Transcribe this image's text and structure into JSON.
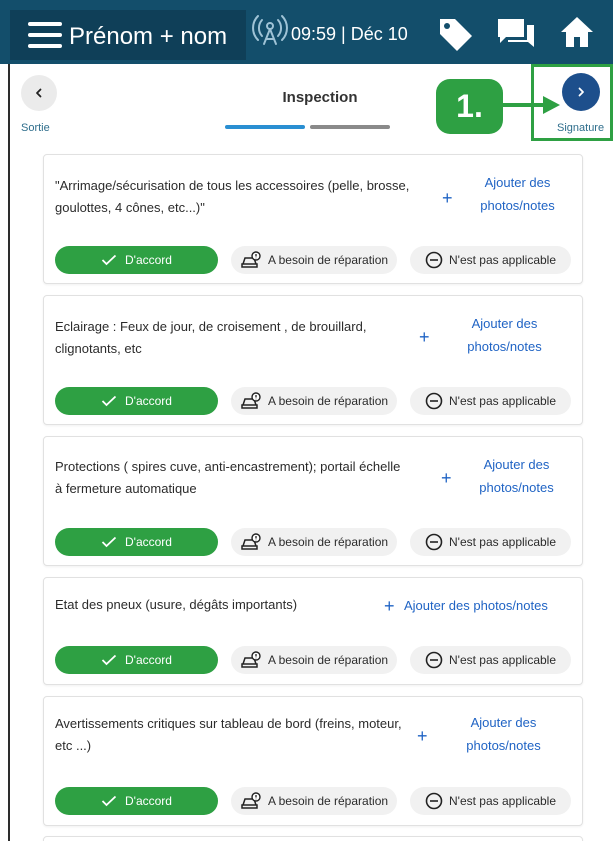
{
  "topbar": {
    "user_name": "Prénom + nom",
    "clock": "09:59 | Déc 10",
    "icons": [
      "menu-icon",
      "signal-icon",
      "tag-icon",
      "chat-icon",
      "home-icon"
    ]
  },
  "header": {
    "title": "Inspection",
    "back_label": "Sortie",
    "next_label": "Signature",
    "step_badge": "1.",
    "progress": {
      "steps": 2,
      "current": 1
    }
  },
  "colors": {
    "topbar": "#134e6b",
    "accent_green": "#2ea043",
    "link_blue": "#1f63c4",
    "next_button": "#1d4f8c",
    "progress_active": "#2a8fd2"
  },
  "items": [
    {
      "question": "\"Arrimage/sécurisation de tous les accessoires (pelle, brosse, goulottes, 4 cônes, etc...)\"",
      "add_label_line1": "Ajouter des",
      "add_label_line2": "photos/notes",
      "ok_label": "D'accord",
      "repair_label": "A besoin de réparation",
      "na_label": "N'est pas applicable",
      "selected": "ok"
    },
    {
      "question": "Eclairage : Feux de jour, de croisement , de brouillard, clignotants, etc",
      "add_label_line1": "Ajouter des",
      "add_label_line2": "photos/notes",
      "ok_label": "D'accord",
      "repair_label": "A besoin de réparation",
      "na_label": "N'est pas applicable",
      "selected": "ok"
    },
    {
      "question": "Protections ( spires cuve, anti-encastrement); portail échelle à fermeture automatique",
      "add_label_line1": "Ajouter des",
      "add_label_line2": "photos/notes",
      "ok_label": "D'accord",
      "repair_label": "A besoin de réparation",
      "na_label": "N'est pas applicable",
      "selected": "ok"
    },
    {
      "question": "Etat des pneux (usure, dégâts importants)",
      "add_label": "Ajouter des photos/notes",
      "ok_label": "D'accord",
      "repair_label": "A besoin de réparation",
      "na_label": "N'est pas applicable",
      "selected": "ok"
    },
    {
      "question": "Avertissements critiques sur tableau de bord (freins, moteur, etc ...)",
      "add_label_line1": "Ajouter des",
      "add_label_line2": "photos/notes",
      "ok_label": "D'accord",
      "repair_label": "A besoin de réparation",
      "na_label": "N'est pas applicable",
      "selected": "ok"
    }
  ]
}
